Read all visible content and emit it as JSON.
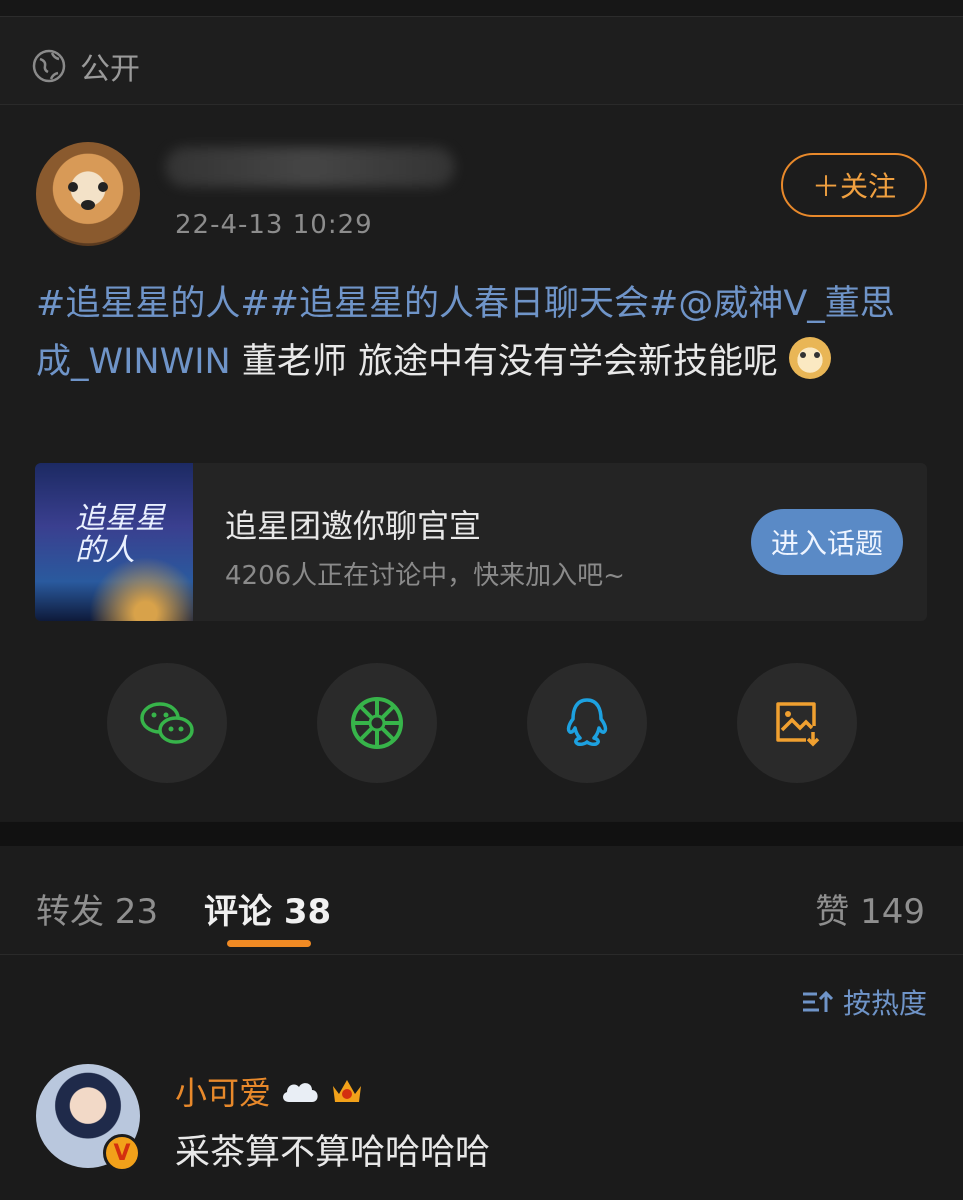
{
  "header": {
    "visibility_label": "公开",
    "visibility_icon": "globe-icon"
  },
  "post": {
    "timestamp": "22-4-13 10:29",
    "follow_label": "＋关注",
    "text_segments": [
      {
        "text": "#追星星的人#",
        "tag": true
      },
      {
        "text": "#追星星的人春日聊天会#",
        "tag": true
      },
      {
        "text": "@威神V_董思成_WINWIN",
        "tag": true
      },
      {
        "text": " 董老师 旅途中有没有学会新技能呢",
        "tag": false
      }
    ],
    "emoji": "dog-face-emoji",
    "topic": {
      "thumb_text": "追星星的人",
      "title": "追星团邀你聊官宣",
      "subtitle": "4206人正在讨论中，快来加入吧~",
      "button": "进入话题"
    },
    "share": [
      {
        "name": "wechat-icon",
        "color": "#37b44a"
      },
      {
        "name": "moments-icon",
        "color": "#37b44a"
      },
      {
        "name": "qq-icon",
        "color": "#1da1e0"
      },
      {
        "name": "save-image-icon",
        "color": "#f0a030"
      }
    ]
  },
  "tabs": {
    "repost": "转发 23",
    "comment": "评论 38",
    "like": "赞 149"
  },
  "sort_label": "按热度",
  "comment": {
    "name": "小可爱",
    "text": "采茶算不算哈哈哈哈",
    "badge": "V"
  },
  "colors": {
    "accent_orange": "#e8892b",
    "link_blue": "#6f94c8",
    "background": "#1b1b1b"
  }
}
